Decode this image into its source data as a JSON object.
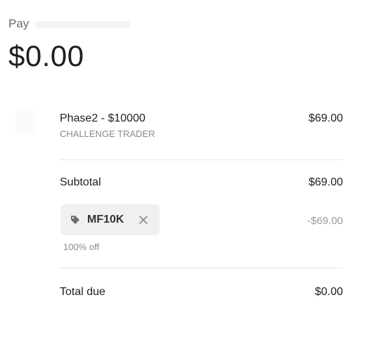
{
  "header": {
    "pay_label": "Pay",
    "amount": "$0.00"
  },
  "line_item": {
    "name": "Phase2 - $10000",
    "subtitle": "CHALLENGE TRADER",
    "price": "$69.00"
  },
  "subtotal": {
    "label": "Subtotal",
    "value": "$69.00"
  },
  "promo": {
    "code": "MF10K",
    "discount_amount": "-$69.00",
    "description": "100% off",
    "icon": "tag-icon",
    "remove_icon": "close-icon"
  },
  "total": {
    "label": "Total due",
    "value": "$0.00"
  }
}
